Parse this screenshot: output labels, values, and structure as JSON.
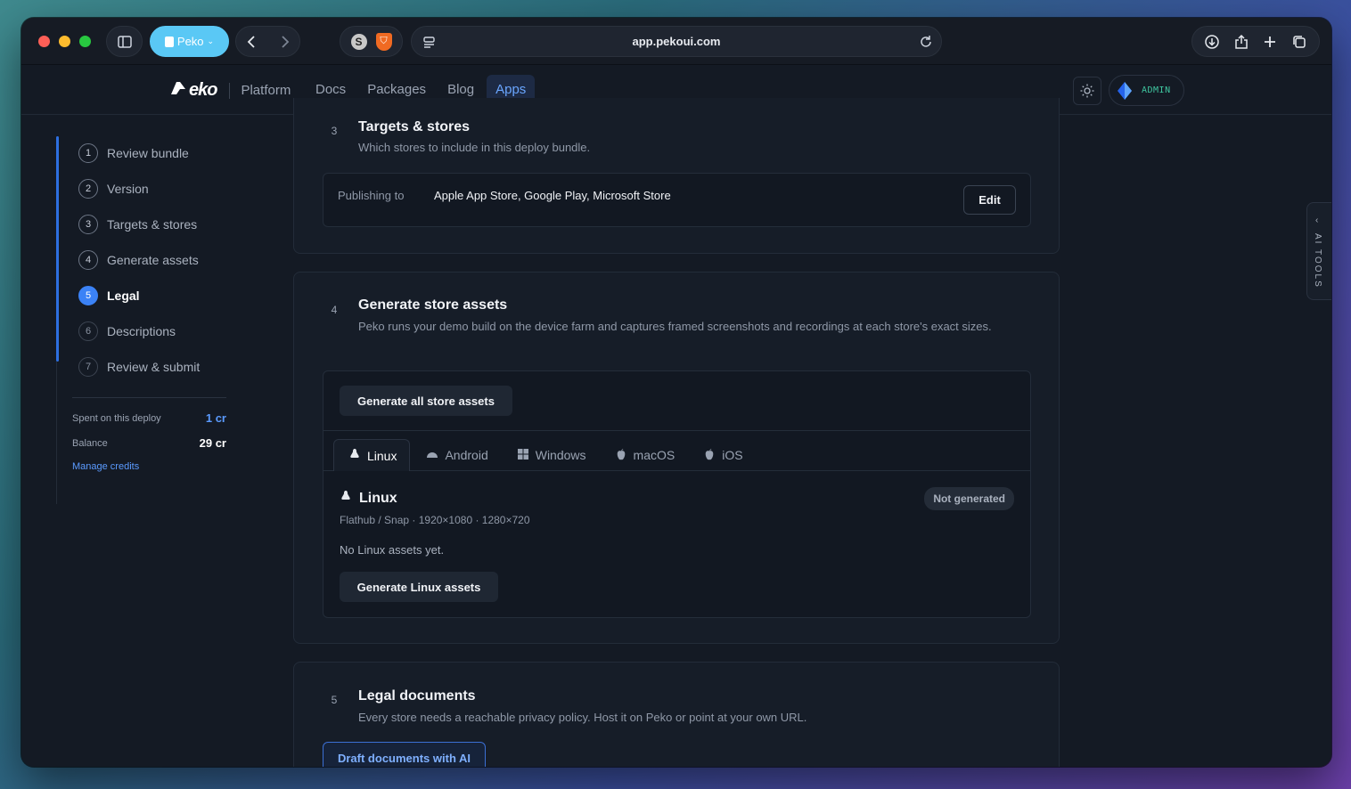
{
  "browser": {
    "profile_label": "Peko",
    "url": "app.pekoui.com",
    "extensions": [
      "S",
      "B"
    ]
  },
  "topnav": {
    "logo_text": "eko",
    "platform_label": "Platform",
    "links": [
      {
        "label": "Docs",
        "active": false
      },
      {
        "label": "Packages",
        "active": false
      },
      {
        "label": "Blog",
        "active": false
      },
      {
        "label": "Apps",
        "active": true
      }
    ],
    "admin_label": "ADMIN"
  },
  "steps": [
    {
      "num": "1",
      "label": "Review bundle"
    },
    {
      "num": "2",
      "label": "Version"
    },
    {
      "num": "3",
      "label": "Targets & stores"
    },
    {
      "num": "4",
      "label": "Generate assets"
    },
    {
      "num": "5",
      "label": "Legal"
    },
    {
      "num": "6",
      "label": "Descriptions"
    },
    {
      "num": "7",
      "label": "Review & submit"
    }
  ],
  "credits": {
    "spent_label": "Spent on this deploy",
    "spent_value": "1 cr",
    "balance_label": "Balance",
    "balance_value": "29 cr",
    "manage_label": "Manage credits"
  },
  "section3": {
    "num": "3",
    "title": "Targets & stores",
    "desc": "Which stores to include in this deploy bundle.",
    "publishing_label": "Publishing to",
    "publishing_value": "Apple App Store, Google Play, Microsoft Store",
    "edit_label": "Edit"
  },
  "section4": {
    "num": "4",
    "title": "Generate store assets",
    "desc": "Peko runs your demo build on the device farm and captures framed screenshots and recordings at each store's exact sizes.",
    "generate_all_label": "Generate all store assets",
    "tabs": [
      {
        "label": "Linux",
        "icon": "linux-icon",
        "active": true
      },
      {
        "label": "Android",
        "icon": "android-icon",
        "active": false
      },
      {
        "label": "Windows",
        "icon": "windows-icon",
        "active": false
      },
      {
        "label": "macOS",
        "icon": "apple-icon",
        "active": false
      },
      {
        "label": "iOS",
        "icon": "apple-icon",
        "active": false
      }
    ],
    "platform_title": "Linux",
    "platform_meta": "Flathub / Snap · 1920×1080 · 1280×720",
    "status_badge": "Not generated",
    "empty_text": "No Linux assets yet.",
    "generate_platform_label": "Generate Linux assets"
  },
  "section5": {
    "num": "5",
    "title": "Legal documents",
    "desc": "Every store needs a reachable privacy policy. Host it on Peko or point at your own URL.",
    "draft_label": "Draft documents with AI"
  },
  "ai_tools_label": "AI TOOLS",
  "colors": {
    "accent": "#3b82f6",
    "background": "#141a24",
    "admin_text": "#3fc6a0",
    "profile_pill": "#5ac8f5"
  }
}
